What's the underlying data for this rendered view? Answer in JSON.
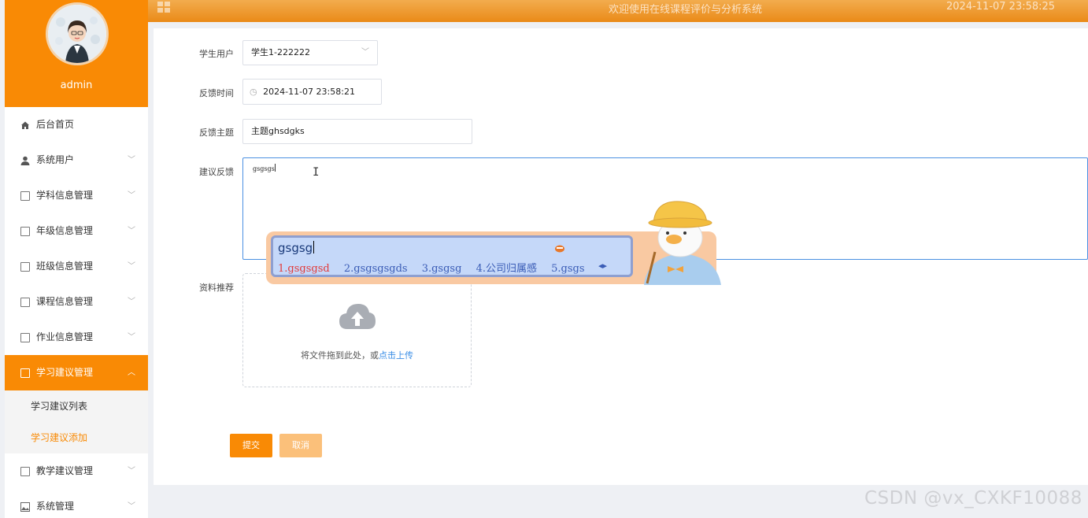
{
  "header": {
    "title": "欢迎使用在线课程评价与分析系统",
    "datetime": "2024-11-07 23:58:25"
  },
  "sidebar": {
    "username": "admin",
    "items": [
      {
        "label": "后台首页",
        "icon": "home-icon",
        "expandable": false
      },
      {
        "label": "系统用户",
        "icon": "user-icon",
        "expandable": true
      },
      {
        "label": "学科信息管理",
        "icon": "document-icon",
        "expandable": true
      },
      {
        "label": "年级信息管理",
        "icon": "document-icon",
        "expandable": true
      },
      {
        "label": "班级信息管理",
        "icon": "document-icon",
        "expandable": true
      },
      {
        "label": "课程信息管理",
        "icon": "document-icon",
        "expandable": true
      },
      {
        "label": "作业信息管理",
        "icon": "document-icon",
        "expandable": true
      },
      {
        "label": "学习建议管理",
        "icon": "document-icon",
        "expandable": true,
        "active": true
      },
      {
        "label": "教学建议管理",
        "icon": "document-icon",
        "expandable": true
      },
      {
        "label": "系统管理",
        "icon": "image-icon",
        "expandable": true
      }
    ],
    "subitems": [
      {
        "label": "学习建议列表",
        "selected": false
      },
      {
        "label": "学习建议添加",
        "selected": true
      }
    ]
  },
  "form": {
    "student": {
      "label": "学生用户",
      "value": "学生1-222222"
    },
    "time": {
      "label": "反馈时间",
      "value": "2024-11-07 23:58:21"
    },
    "subject": {
      "label": "反馈主题",
      "value": "主题ghsdgks"
    },
    "suggestion": {
      "label": "建议反馈",
      "value": "gsgsgs"
    },
    "upload": {
      "label": "资料推荐",
      "text": "将文件拖到此处，或",
      "link": "点击上传"
    },
    "submit_label": "提交",
    "cancel_label": "取消"
  },
  "ime": {
    "input": "gsgsg",
    "candidates": [
      "1.gsgsgsd",
      "2.gsgsgsgds",
      "3.gsgsg",
      "4.公司归属感",
      "5.gsgs"
    ]
  },
  "watermark": "CSDN @vx_CXKF10088",
  "colors": {
    "accent": "#f98a05",
    "link": "#3a8ee6",
    "candidate_first": "#e23b3b"
  }
}
